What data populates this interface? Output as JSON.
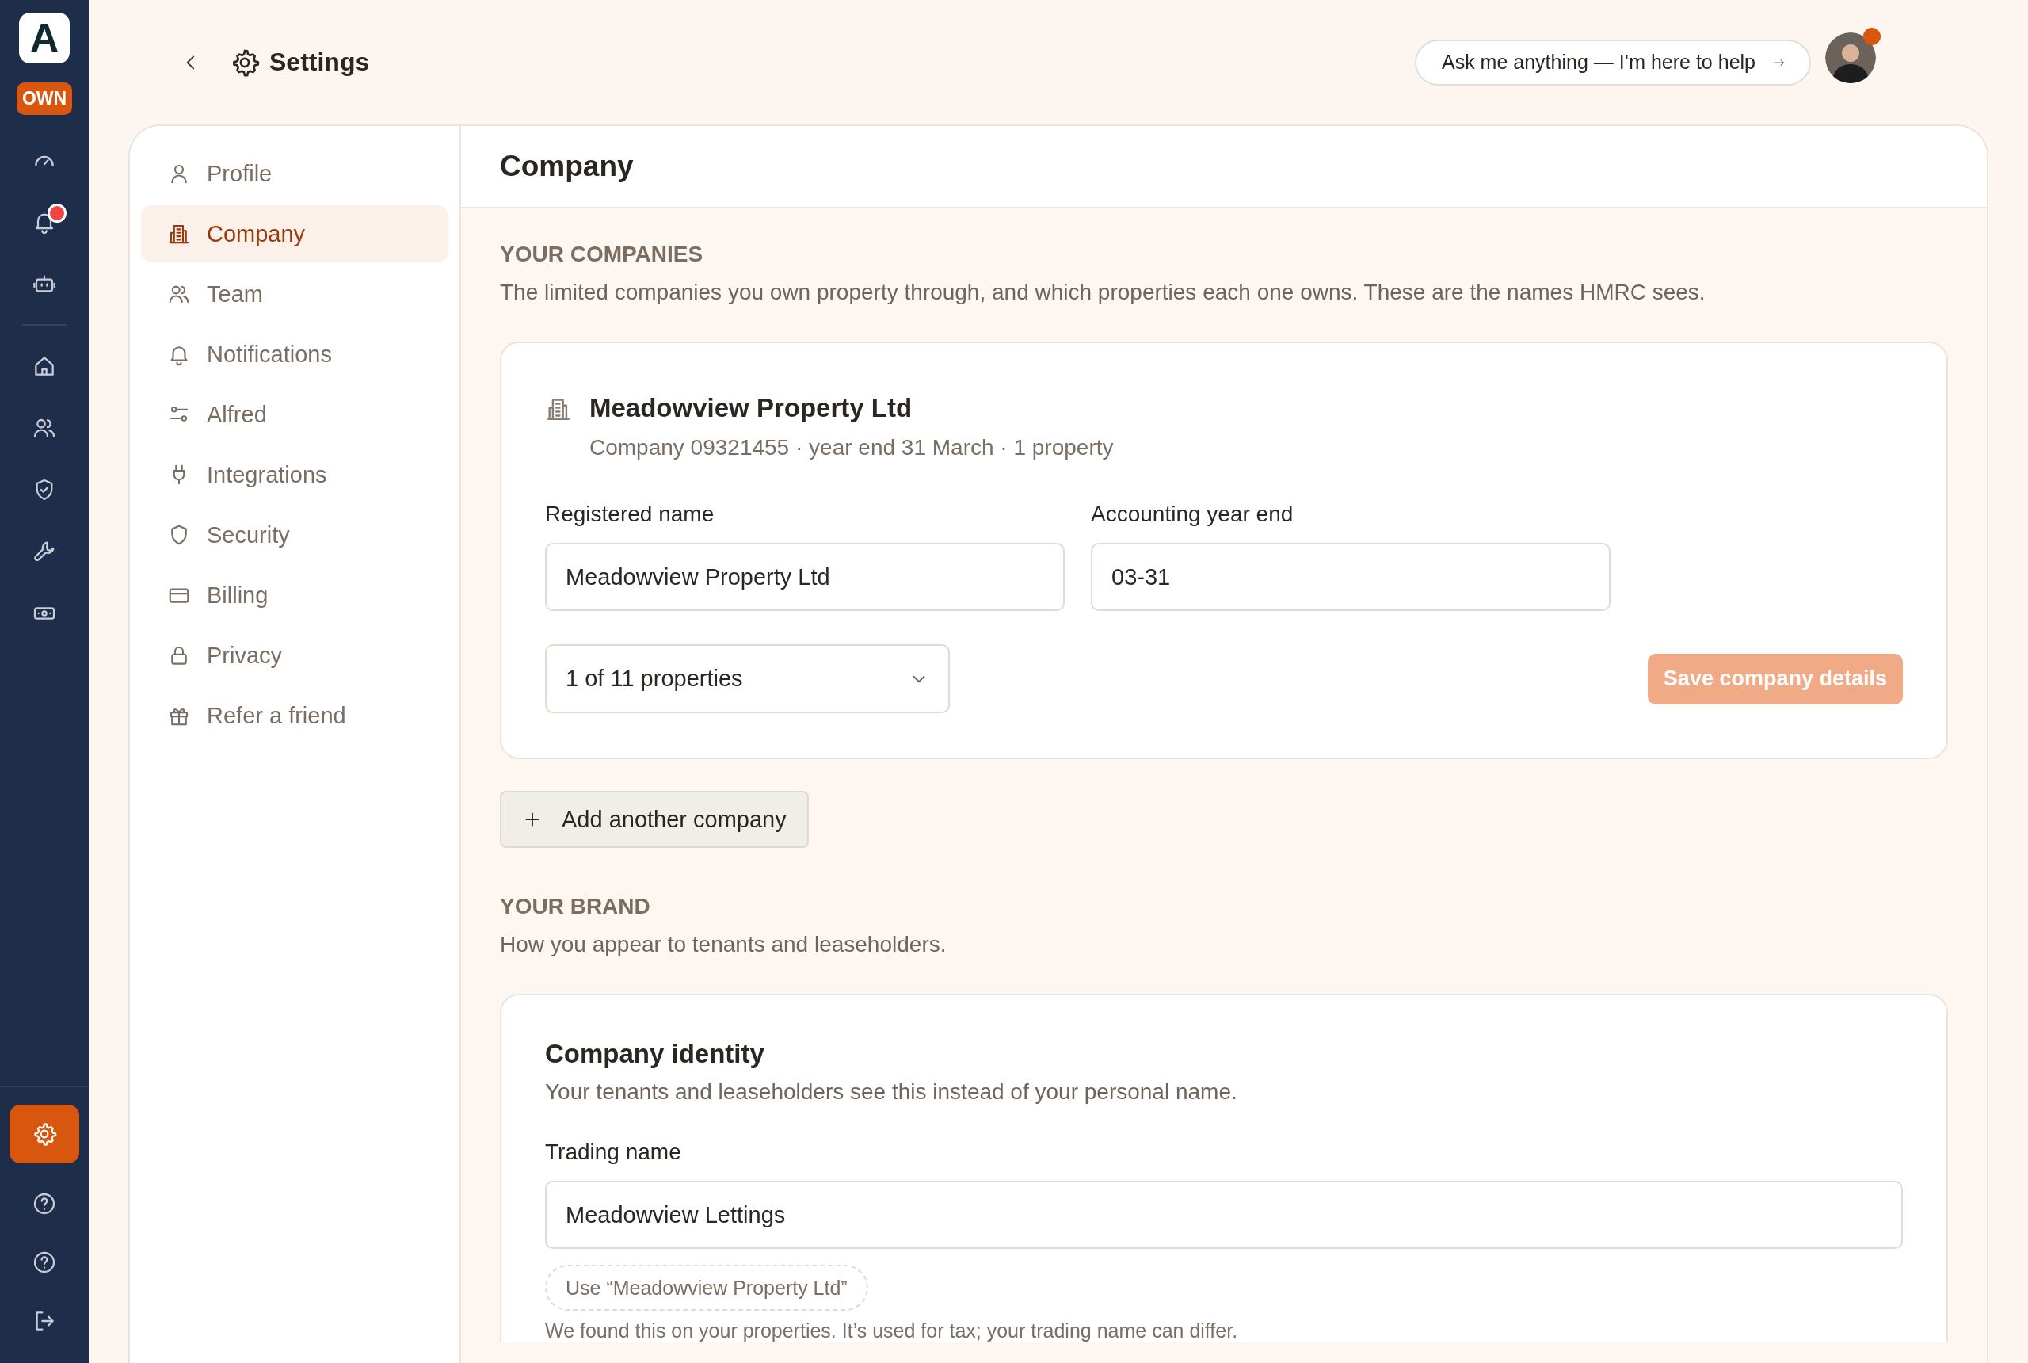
{
  "rail": {
    "logo": "A",
    "plan": "OWN",
    "primary": [
      {
        "selected": false,
        "badge": false
      },
      {
        "selected": false,
        "badge": true
      },
      {
        "selected": false,
        "badge": false
      }
    ],
    "secondary": [
      {
        "selected": false,
        "badge": false
      },
      {
        "selected": false,
        "badge": false
      },
      {
        "selected": false,
        "badge": false
      },
      {
        "selected": false,
        "badge": false
      },
      {
        "selected": false,
        "badge": false
      }
    ],
    "footer": [
      {
        "selected": true,
        "badge": false
      },
      {
        "selected": false,
        "badge": false
      },
      {
        "selected": false,
        "badge": false
      },
      {
        "selected": false,
        "badge": false
      }
    ]
  },
  "header": {
    "title": "Settings",
    "assistant_prompt": "Ask me anything — I’m here to help",
    "avatar": {
      "notification": true
    }
  },
  "settings_nav": [
    {
      "label": "Profile",
      "selected": false
    },
    {
      "label": "Company",
      "selected": true
    },
    {
      "label": "Team",
      "selected": false
    },
    {
      "label": "Notifications",
      "selected": false
    },
    {
      "label": "Alfred",
      "selected": false
    },
    {
      "label": "Integrations",
      "selected": false
    },
    {
      "label": "Security",
      "selected": false
    },
    {
      "label": "Billing",
      "selected": false
    },
    {
      "label": "Privacy",
      "selected": false
    },
    {
      "label": "Refer a friend",
      "selected": false
    }
  ],
  "page": {
    "title": "Company"
  },
  "companies": {
    "heading": "YOUR COMPANIES",
    "description": "The limited companies you own property through, and which properties each one owns. These are the names HMRC sees.",
    "cards": [
      {
        "name": "Meadowview Property Ltd",
        "meta": "Company 09321455 · year end 31 March · 1 property",
        "fields": [
          {
            "label": "Registered name",
            "value": "Meadowview Property Ltd"
          },
          {
            "label": "Accounting year end",
            "value": "03-31"
          }
        ],
        "properties_select": "1 of 11 properties",
        "save_button": {
          "label": "Save company details",
          "disabled": true
        }
      }
    ],
    "add_button": "Add another company"
  },
  "brand": {
    "heading": "YOUR BRAND",
    "description": "How you appear to tenants and leaseholders.",
    "identity": {
      "title": "Company identity",
      "description": "Your tenants and leaseholders see this instead of your personal name.",
      "field": {
        "label": "Trading name",
        "value": "Meadowview Lettings"
      },
      "suggestion": "Use “Meadowview Property Ltd”",
      "note": "We found this on your properties. It’s used for tax; your trading name can differ."
    }
  }
}
